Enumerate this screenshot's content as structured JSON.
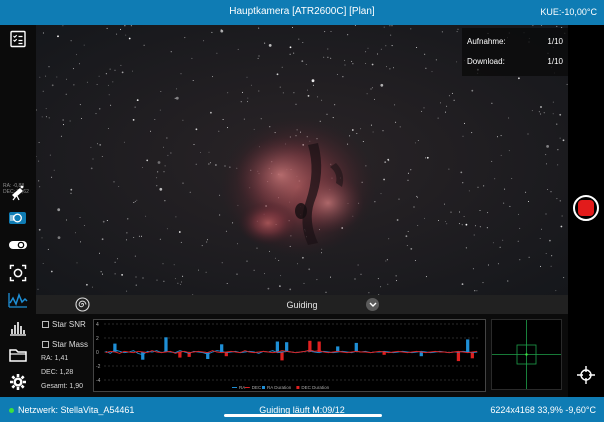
{
  "topbar": {
    "title": "Hauptkamera [ATR2600C] [Plan]",
    "kue": "KUE:-10,00°C"
  },
  "sidebar_left": {
    "ra_dec_mini": [
      "RA: -0,88",
      "DEC: 36,62"
    ],
    "icons": [
      "checklist-icon",
      "telescope-icon",
      "camera-icon",
      "filter-wheel-icon",
      "focus-frame-icon",
      "guiding-chart-icon",
      "histogram-icon",
      "folder-icon",
      "settings-gear-icon"
    ]
  },
  "progress": {
    "aufnahme_label": "Aufnahme:",
    "aufnahme_value": "1/10",
    "download_label": "Download:",
    "download_value": "1/10"
  },
  "guiding": {
    "title": "Guiding",
    "star_snr_label": "Star SNR",
    "star_mass_label": "Star Mass",
    "ra": "RA: 1,41",
    "dec": "DEC: 1,28",
    "total": "Gesamt: 1,90"
  },
  "chart_data": {
    "type": "line",
    "y_ticks": [
      "4",
      "2",
      "0",
      "-2",
      "-4"
    ],
    "ylim": [
      -4,
      4
    ],
    "legend": [
      "RA",
      "DEC",
      "RA Duration",
      "DEC Duration"
    ],
    "colors": {
      "RA": "#1e8fd6",
      "DEC": "#e02020",
      "RA Duration": "#1e8fd6",
      "DEC Duration": "#e02020"
    },
    "ra_duration": [
      0,
      0,
      1.2,
      0,
      0,
      0,
      0,
      0,
      -1.1,
      0,
      0,
      0,
      0,
      2.1,
      0,
      0,
      0,
      0,
      0,
      0,
      0,
      0,
      -1.0,
      0,
      0,
      1.1,
      0,
      0,
      0,
      0,
      0,
      0,
      0,
      0,
      0,
      0,
      0,
      1.5,
      0,
      1.4,
      0,
      0,
      0,
      0,
      0,
      0,
      0,
      0,
      0,
      0,
      0.8,
      0,
      0,
      0,
      1.3,
      0,
      0,
      0,
      0,
      0,
      0,
      0,
      0,
      0,
      0,
      0,
      0,
      0,
      -0.6,
      0,
      0,
      0,
      0,
      0,
      0,
      0,
      0,
      0,
      1.8,
      0,
      0
    ],
    "dec_duration": [
      0,
      0,
      0,
      0,
      0,
      0,
      0,
      0,
      0,
      0,
      0,
      0,
      0,
      0,
      0,
      0,
      -0.8,
      0,
      -0.7,
      0,
      0,
      0,
      0,
      0,
      0,
      0,
      -0.6,
      0,
      0,
      0,
      0,
      0,
      0,
      0,
      0,
      0,
      0,
      0,
      -1.2,
      0,
      0,
      0,
      0,
      0,
      1.6,
      0,
      1.5,
      0,
      0,
      0,
      0,
      0,
      0,
      0,
      0,
      0,
      0,
      0,
      0,
      0,
      -0.4,
      0,
      0,
      0,
      0,
      0,
      0,
      0,
      0,
      0,
      0,
      0,
      0,
      0,
      0,
      0,
      -1.3,
      0,
      0,
      -0.9,
      0
    ],
    "ra_line": [
      0.1,
      -0.2,
      0.3,
      0.1,
      -0.1,
      0.0,
      0.2,
      -0.2,
      -0.4,
      0.1,
      0.0,
      0.2,
      -0.1,
      0.1,
      0.0,
      -0.1,
      0.2,
      0.0,
      -0.2,
      0.1,
      0.0,
      -0.1,
      -0.3,
      0.0,
      0.2,
      0.1,
      -0.1,
      0.0,
      0.1,
      -0.1,
      0.0,
      0.1,
      0.0,
      -0.2,
      0.1,
      0.0,
      0.2,
      -0.1,
      0.0,
      0.1,
      0.0,
      -0.1,
      0.0,
      0.1,
      0.2,
      0.0,
      -0.1,
      0.1,
      0.0,
      -0.1,
      0.0,
      0.1,
      0.0,
      -0.1,
      0.1,
      0.0,
      0.1,
      -0.1,
      0.0,
      0.0,
      0.1,
      0.0,
      -0.1,
      0.0,
      0.1,
      0.0,
      -0.1,
      0.0,
      0.1,
      0.0,
      -0.1,
      0.0,
      0.1,
      0.0,
      -0.1,
      0.0,
      0.0,
      0.1,
      0.0,
      -0.1,
      0.0
    ],
    "dec_line": [
      -0.1,
      0.1,
      0.0,
      -0.2,
      0.1,
      0.0,
      -0.1,
      0.1,
      0.0,
      -0.1,
      0.2,
      0.0,
      -0.1,
      0.0,
      0.1,
      -0.2,
      0.0,
      0.1,
      -0.1,
      0.0,
      0.1,
      0.0,
      -0.1,
      0.2,
      0.0,
      -0.1,
      0.0,
      0.1,
      0.0,
      -0.1,
      0.2,
      0.0,
      -0.1,
      0.0,
      0.1,
      0.0,
      -0.1,
      0.0,
      0.2,
      0.1,
      0.0,
      -0.1,
      0.0,
      0.1,
      0.3,
      0.1,
      0.2,
      0.0,
      -0.1,
      0.0,
      0.1,
      0.0,
      -0.1,
      0.0,
      0.1,
      0.0,
      0.0,
      -0.1,
      0.0,
      0.1,
      0.0,
      -0.1,
      0.0,
      0.1,
      0.0,
      -0.1,
      0.0,
      0.1,
      0.0,
      -0.1,
      0.0,
      0.1,
      0.0,
      0.0,
      -0.1,
      0.0,
      0.1,
      0.0,
      -0.1,
      0.0,
      0.1
    ]
  },
  "bottombar": {
    "network": "Netzwerk: StellaVita_A54461",
    "status": "Guiding läuft M:09/12",
    "info": "6224x4168  33,9%  -9,60°C"
  }
}
